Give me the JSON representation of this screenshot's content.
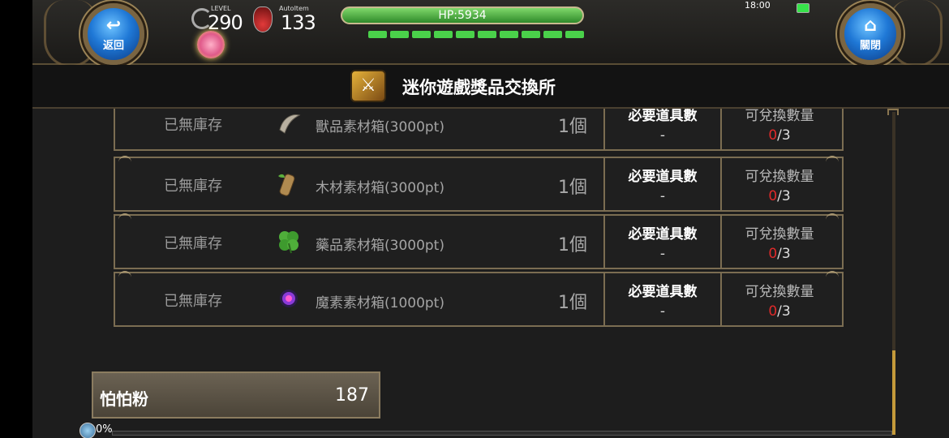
{
  "header": {
    "back_label": "返回",
    "close_label": "關閉",
    "level_label": "LEVEL",
    "level_value": "290",
    "autoitem_label": "AutoItem",
    "autoitem_value": "133",
    "hp_text": "HP:5934",
    "hp_segments": 10,
    "time": "18:00"
  },
  "title": {
    "text": "迷你遊戲獎品交換所",
    "icon": "crate-sword-icon"
  },
  "rows": [
    {
      "status": "已無庫存",
      "name": "獸品素材箱(3000pt)",
      "qty": "1個",
      "req_label": "必要道具數",
      "req_value": "-",
      "ex_label": "可兌換數量",
      "ex_used": "0",
      "ex_max": "/3",
      "icon": "fang-icon"
    },
    {
      "status": "已無庫存",
      "name": "木材素材箱(3000pt)",
      "qty": "1個",
      "req_label": "必要道具數",
      "req_value": "-",
      "ex_label": "可兌換數量",
      "ex_used": "0",
      "ex_max": "/3",
      "icon": "wood-log-icon"
    },
    {
      "status": "已無庫存",
      "name": "藥品素材箱(3000pt)",
      "qty": "1個",
      "req_label": "必要道具數",
      "req_value": "-",
      "ex_label": "可兌換數量",
      "ex_used": "0",
      "ex_max": "/3",
      "icon": "herb-leaf-icon"
    },
    {
      "status": "已無庫存",
      "name": "魔素素材箱(1000pt)",
      "qty": "1個",
      "req_label": "必要道具數",
      "req_value": "-",
      "ex_label": "可兌換數量",
      "ex_used": "0",
      "ex_max": "/3",
      "icon": "magic-orb-icon"
    }
  ],
  "currency": {
    "name": "怕怕粉",
    "amount": "187"
  },
  "exp": {
    "percent_text": "0%"
  },
  "colors": {
    "accent_gold": "#c49a3a",
    "hp_green": "#4ad14a",
    "button_blue": "#1f78d6",
    "zero_red": "#e02a2a"
  }
}
